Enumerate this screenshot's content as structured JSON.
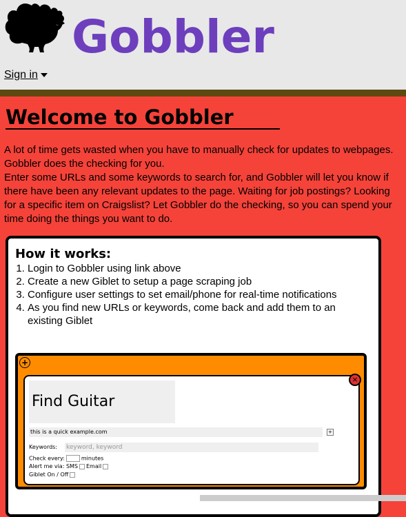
{
  "header": {
    "brand": "Gobbler",
    "signin_label": "Sign in",
    "logo_icon": "turkey-icon",
    "colors": {
      "brand": "#6d3fbd",
      "header_bg": "#e8e8e8",
      "divider": "#5e4a10",
      "page_bg": "#f5433a"
    }
  },
  "main": {
    "title": "Welcome to Gobbler",
    "intro_1": "A lot of time gets wasted when you have to manually check for updates to webpages. Gobbler does the checking for you.",
    "intro_2": "Enter some URLs and some keywords to search for, and Gobbler will let you know if there have been any relevant updates to the page. Waiting for job postings? Looking for a specific item on Craigslist? Let Gobbler do the checking, so you can spend your time doing the things you want to do."
  },
  "how": {
    "heading": "How it works:",
    "steps": [
      "Login to Gobbler using link above",
      "Create a new Giblet to setup a page scraping job",
      "Configure user settings to set email/phone for real-time notifications",
      "As you find new URLs or keywords, come back and add them to an existing Giblet"
    ]
  },
  "demo": {
    "giblet_title": "Find Guitar",
    "url_value": "this is a quick example.com",
    "keywords_label": "Keywords:",
    "keywords_placeholder": "keyword, keyword",
    "check_every_label": "Check every:",
    "minutes_label": "minutes",
    "alert_label": "Alert me via: SMS",
    "email_label": "Email",
    "onoff_label": "Giblet On / Off",
    "colors": {
      "demo_bg": "#ff8c00"
    }
  }
}
